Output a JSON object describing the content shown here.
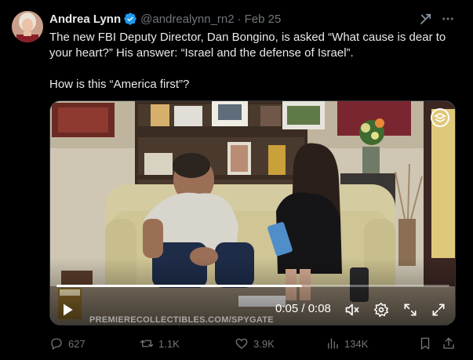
{
  "post": {
    "author_name": "Andrea Lynn",
    "handle": "@andrealynn_rn2",
    "separator": "·",
    "date": "Feb 25",
    "text_line1": "The new FBI Deputy Director, Dan Bongino, is asked “What cause is dear to your heart?” His answer: “Israel and the defense of Israel”.",
    "text_line2": "How is this “America first”?"
  },
  "video": {
    "time_display": "0:05 / 0:08",
    "progress": 0.625,
    "watermark": "PREMIERECOLLECTIBLES.COM/SPYGATE",
    "book_label": "SPYGATE"
  },
  "actions": {
    "replies": "627",
    "reposts": "1.1K",
    "likes": "3.9K",
    "views": "134K"
  },
  "colors": {
    "background": "#000000",
    "text": "#e7e9ea",
    "muted": "#71767b",
    "verified": "#1d9bf0"
  },
  "icons": [
    "verified-badge-icon",
    "grok-icon",
    "more-icon",
    "play-icon",
    "mute-icon",
    "settings-icon",
    "minimize-icon",
    "fullscreen-icon",
    "reply-icon",
    "repost-icon",
    "like-icon",
    "views-icon",
    "bookmark-icon",
    "share-icon"
  ]
}
